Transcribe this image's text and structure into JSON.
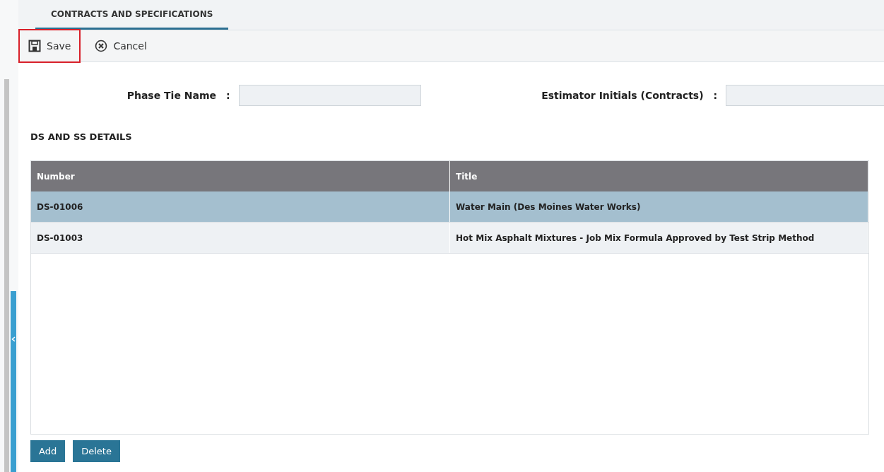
{
  "tabs": [
    {
      "label": "CONTRACTS AND SPECIFICATIONS",
      "selected": true
    }
  ],
  "toolbar": [
    {
      "kind": "save",
      "label": "Save",
      "highlighted": true
    },
    {
      "kind": "cancel",
      "label": "Cancel",
      "highlighted": false
    }
  ],
  "fields": [
    {
      "label": "Phase Tie Name",
      "separator": ":"
    },
    {
      "label": "Estimator Initials (Contracts)",
      "separator": ":"
    }
  ],
  "section_title": "DS AND SS DETAILS",
  "table": {
    "columns": [
      "Number",
      "Title"
    ],
    "rows": [
      {
        "cells": [
          "DS-01006",
          "Water Main (Des Moines Water Works)"
        ],
        "selected": true
      },
      {
        "cells": [
          "DS-01003",
          "Hot Mix Asphalt Mixtures - Job Mix Formula Approved by Test Strip Method"
        ],
        "selected": false
      }
    ]
  },
  "buttons": [
    "Add",
    "Delete"
  ]
}
